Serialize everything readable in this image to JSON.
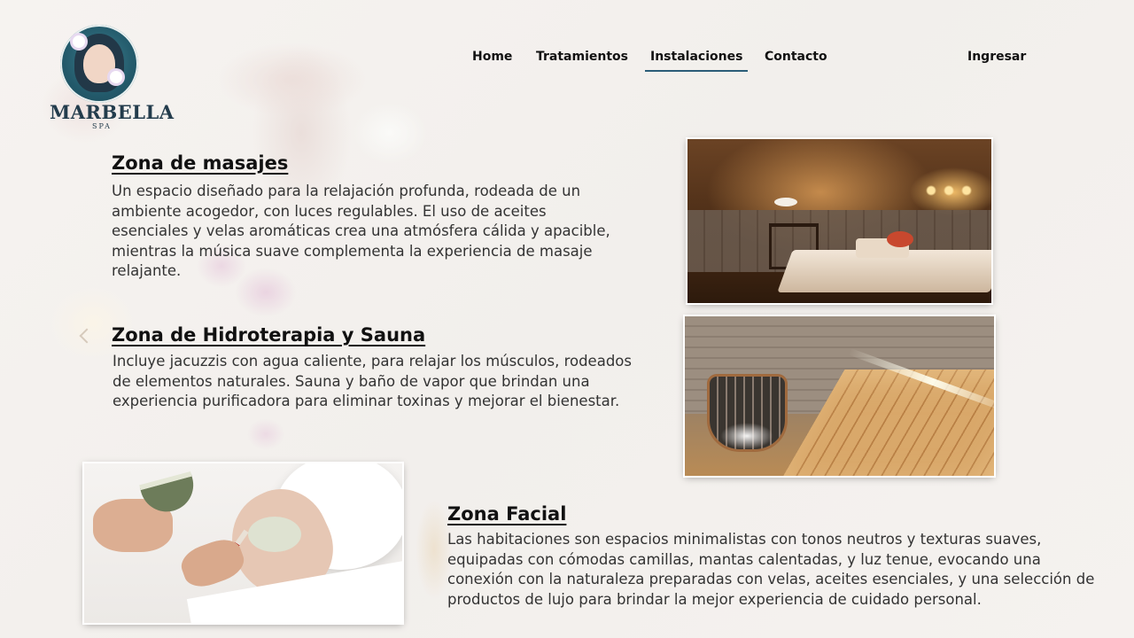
{
  "brand": {
    "name": "MARBELLA",
    "sub": "SPA"
  },
  "nav": {
    "items": [
      {
        "label": "Home",
        "active": false
      },
      {
        "label": "Tratamientos",
        "active": false
      },
      {
        "label": "Instalaciones",
        "active": true
      },
      {
        "label": "Contacto",
        "active": false
      }
    ],
    "login_label": "Ingresar"
  },
  "sections": [
    {
      "title": "Zona de masajes",
      "text": "Un espacio diseñado para la relajación profunda, rodeada de un ambiente acogedor, con luces regulables. El uso de aceites esenciales y velas aromáticas crea una atmósfera cálida y apacible, mientras la música suave complementa la experiencia de masaje relajante."
    },
    {
      "title": "Zona de Hidroterapia y Sauna",
      "text": "Incluye jacuzzis con agua caliente, para relajar los músculos, rodeados de elementos naturales. Sauna y baño de vapor que brindan una experiencia purificadora para eliminar toxinas y mejorar el bienestar."
    },
    {
      "title": "Zona Facial",
      "text": "Las habitaciones son espacios minimalistas con tonos neutros y texturas suaves, equipadas con cómodas camillas, mantas calentadas, y luz tenue, evocando una conexión con la naturaleza preparadas con velas, aceites esenciales, y una selección de productos de lujo para brindar la mejor experiencia de cuidado personal."
    }
  ],
  "colors": {
    "nav_underline": "#2b5d78",
    "logo": "#233c4c"
  }
}
